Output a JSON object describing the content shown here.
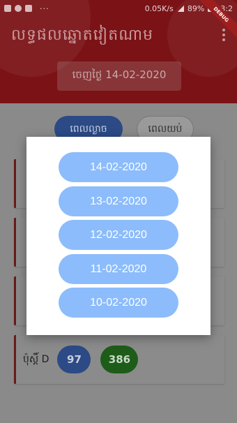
{
  "status_bar": {
    "speed": "0.05K/s",
    "battery": "89%",
    "time": "23:2",
    "debug_banner": "DEBUG"
  },
  "app_bar": {
    "title": "លទ្ធផលឆ្នោតវៀតណាម",
    "menu_icon": "more-vert-icon"
  },
  "date_selector": {
    "label": "ចេញថ្ងៃ 14-02-2020"
  },
  "tabs": [
    {
      "label": "ពេលល្ងាច"
    },
    {
      "label": "ពេលយប់"
    }
  ],
  "result_card": {
    "label": "ប៉ុស្តិ៍ D",
    "numbers": [
      "97",
      "386"
    ]
  },
  "date_dialog": {
    "options": [
      "14-02-2020",
      "13-02-2020",
      "12-02-2020",
      "11-02-2020",
      "10-02-2020"
    ]
  },
  "colors": {
    "app_red": "#7b1216",
    "option_blue": "#8cbcfb",
    "badge_blue": "#2c4a85",
    "badge_green": "#1e5c1a"
  }
}
